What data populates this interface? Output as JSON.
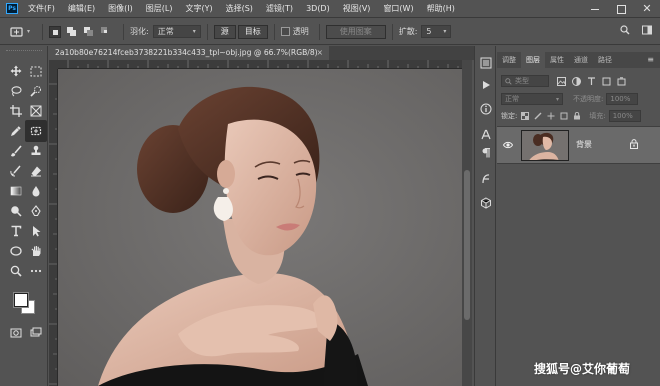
{
  "app": {
    "logo_text": "Ps"
  },
  "menubar": {
    "items": [
      "文件(F)",
      "编辑(E)",
      "图像(I)",
      "图层(L)",
      "文字(Y)",
      "选择(S)",
      "滤镜(T)",
      "3D(D)",
      "视图(V)",
      "窗口(W)",
      "帮助(H)"
    ]
  },
  "options_bar": {
    "feather_label": "羽化:",
    "style_value": "正常",
    "btn_source": "源",
    "btn_destination": "目标",
    "transparent_label": "透明",
    "use_pattern_label": "使用图案",
    "diffusion_label": "扩散:",
    "diffusion_value": "5"
  },
  "document": {
    "tab_title": "2a10b80e76214fceb3738221b334c433_tpl~obj.jpg @ 66.7%(RGB/8)",
    "close": "×"
  },
  "panel": {
    "tabs": [
      "调整",
      "图层",
      "属性",
      "通道",
      "路径"
    ],
    "active_tab": "图层",
    "filter_placeholder": "类型",
    "blend_mode": "正常",
    "opacity_label": "不透明度:",
    "opacity_value": "100%",
    "lock_label": "锁定:",
    "fill_label": "填充:",
    "fill_value": "100%",
    "layers": [
      {
        "name": "背景",
        "visible": true,
        "locked": true
      }
    ]
  },
  "watermark": "搜狐号@艾你葡萄",
  "colors": {
    "ui_bg": "#535353",
    "canvas_bg": "#6e6c6b",
    "accent": "#31a8ff",
    "selected_layer": "#6a6a6a"
  }
}
